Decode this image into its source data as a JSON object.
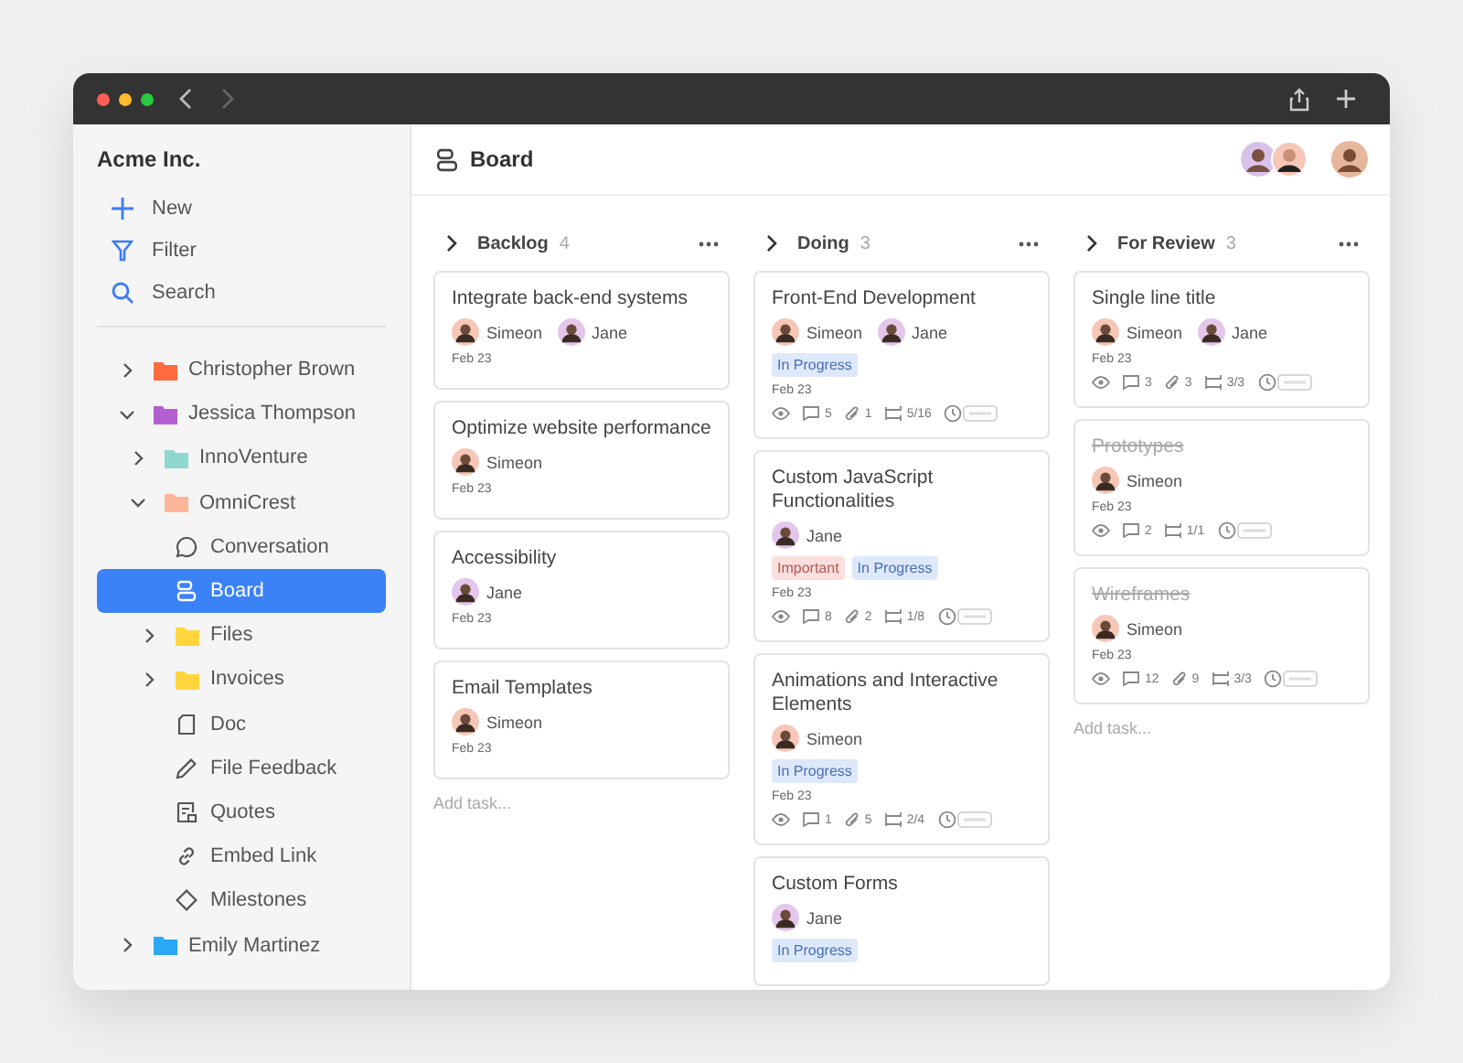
{
  "sidebar": {
    "workspace": "Acme Inc.",
    "actions": [
      {
        "kind": "new",
        "label": "New"
      },
      {
        "kind": "filter",
        "label": "Filter"
      },
      {
        "kind": "search",
        "label": "Search"
      }
    ],
    "tree": [
      {
        "kind": "folder",
        "label": "Christopher Brown",
        "color": "#ff6b3d",
        "expanded": false,
        "selected": false
      },
      {
        "kind": "folder",
        "label": "Jessica Thompson",
        "color": "#b45fd1",
        "expanded": true,
        "selected": false,
        "children": [
          {
            "kind": "folder",
            "label": "InnoVenture",
            "color": "#8ed8d0",
            "expanded": false,
            "selected": false
          },
          {
            "kind": "folder",
            "label": "OmniCrest",
            "color": "#ffb59a",
            "expanded": true,
            "selected": false,
            "children": [
              {
                "kind": "chat",
                "label": "Conversation",
                "selected": false
              },
              {
                "kind": "board",
                "label": "Board",
                "selected": true
              },
              {
                "kind": "folder",
                "label": "Files",
                "color": "#ffd53d",
                "expanded": false,
                "selected": false
              },
              {
                "kind": "folder",
                "label": "Invoices",
                "color": "#ffd53d",
                "expanded": false,
                "selected": false
              },
              {
                "kind": "doc",
                "label": "Doc",
                "selected": false
              },
              {
                "kind": "pencil",
                "label": "File Feedback",
                "selected": false
              },
              {
                "kind": "quote",
                "label": "Quotes",
                "selected": false
              },
              {
                "kind": "link",
                "label": "Embed Link",
                "selected": false
              },
              {
                "kind": "diamond",
                "label": "Milestones",
                "selected": false
              }
            ]
          }
        ]
      },
      {
        "kind": "folder",
        "label": "Emily Martinez",
        "color": "#2aa8f5",
        "expanded": false,
        "selected": false
      }
    ]
  },
  "header": {
    "title": "Board"
  },
  "columns": [
    {
      "name": "Backlog",
      "count": "4",
      "add": "Add task...",
      "cards": [
        {
          "title": "Integrate back-end systems",
          "done": false,
          "assignees": [
            "Simeon",
            "Jane"
          ],
          "date": "Feb 23"
        },
        {
          "title": "Optimize website performance",
          "done": false,
          "assignees": [
            "Simeon"
          ],
          "date": "Feb 23"
        },
        {
          "title": "Accessibility",
          "done": false,
          "assignees": [
            "Jane"
          ],
          "date": "Feb 23"
        },
        {
          "title": "Email Templates",
          "done": false,
          "assignees": [
            "Simeon"
          ],
          "date": "Feb 23"
        }
      ]
    },
    {
      "name": "Doing",
      "count": "3",
      "cards": [
        {
          "title": "Front-End Development",
          "done": false,
          "assignees": [
            "Simeon",
            "Jane"
          ],
          "tags": [
            {
              "kind": "progress",
              "label": "In Progress"
            }
          ],
          "date": "Feb 23",
          "stats": {
            "comments": "5",
            "attachments": "1",
            "subtasks": "5/16"
          }
        },
        {
          "title": "Custom JavaScript Functionalities",
          "done": false,
          "assignees": [
            "Jane"
          ],
          "tags": [
            {
              "kind": "important",
              "label": "Important"
            },
            {
              "kind": "progress",
              "label": "In Progress"
            }
          ],
          "date": "Feb 23",
          "stats": {
            "comments": "8",
            "attachments": "2",
            "subtasks": "1/8"
          }
        },
        {
          "title": "Animations and Interactive Elements",
          "done": false,
          "assignees": [
            "Simeon"
          ],
          "tags": [
            {
              "kind": "progress",
              "label": "In Progress"
            }
          ],
          "date": "Feb 23",
          "stats": {
            "comments": "1",
            "attachments": "5",
            "subtasks": "2/4"
          }
        },
        {
          "title": "Custom Forms",
          "done": false,
          "assignees": [
            "Jane"
          ],
          "tags": [
            {
              "kind": "progress",
              "label": "In Progress"
            }
          ]
        }
      ]
    },
    {
      "name": "For Review",
      "count": "3",
      "add": "Add task...",
      "cards": [
        {
          "title": "Single line title",
          "done": false,
          "assignees": [
            "Simeon",
            "Jane"
          ],
          "date": "Feb 23",
          "stats": {
            "comments": "3",
            "attachments": "3",
            "subtasks": "3/3"
          }
        },
        {
          "title": "Prototypes",
          "done": true,
          "assignees": [
            "Simeon"
          ],
          "date": "Feb 23",
          "stats": {
            "comments": "2",
            "subtasks": "1/1"
          }
        },
        {
          "title": "Wireframes",
          "done": true,
          "assignees": [
            "Simeon"
          ],
          "date": "Feb 23",
          "stats": {
            "comments": "12",
            "attachments": "9",
            "subtasks": "3/3"
          }
        }
      ]
    }
  ]
}
